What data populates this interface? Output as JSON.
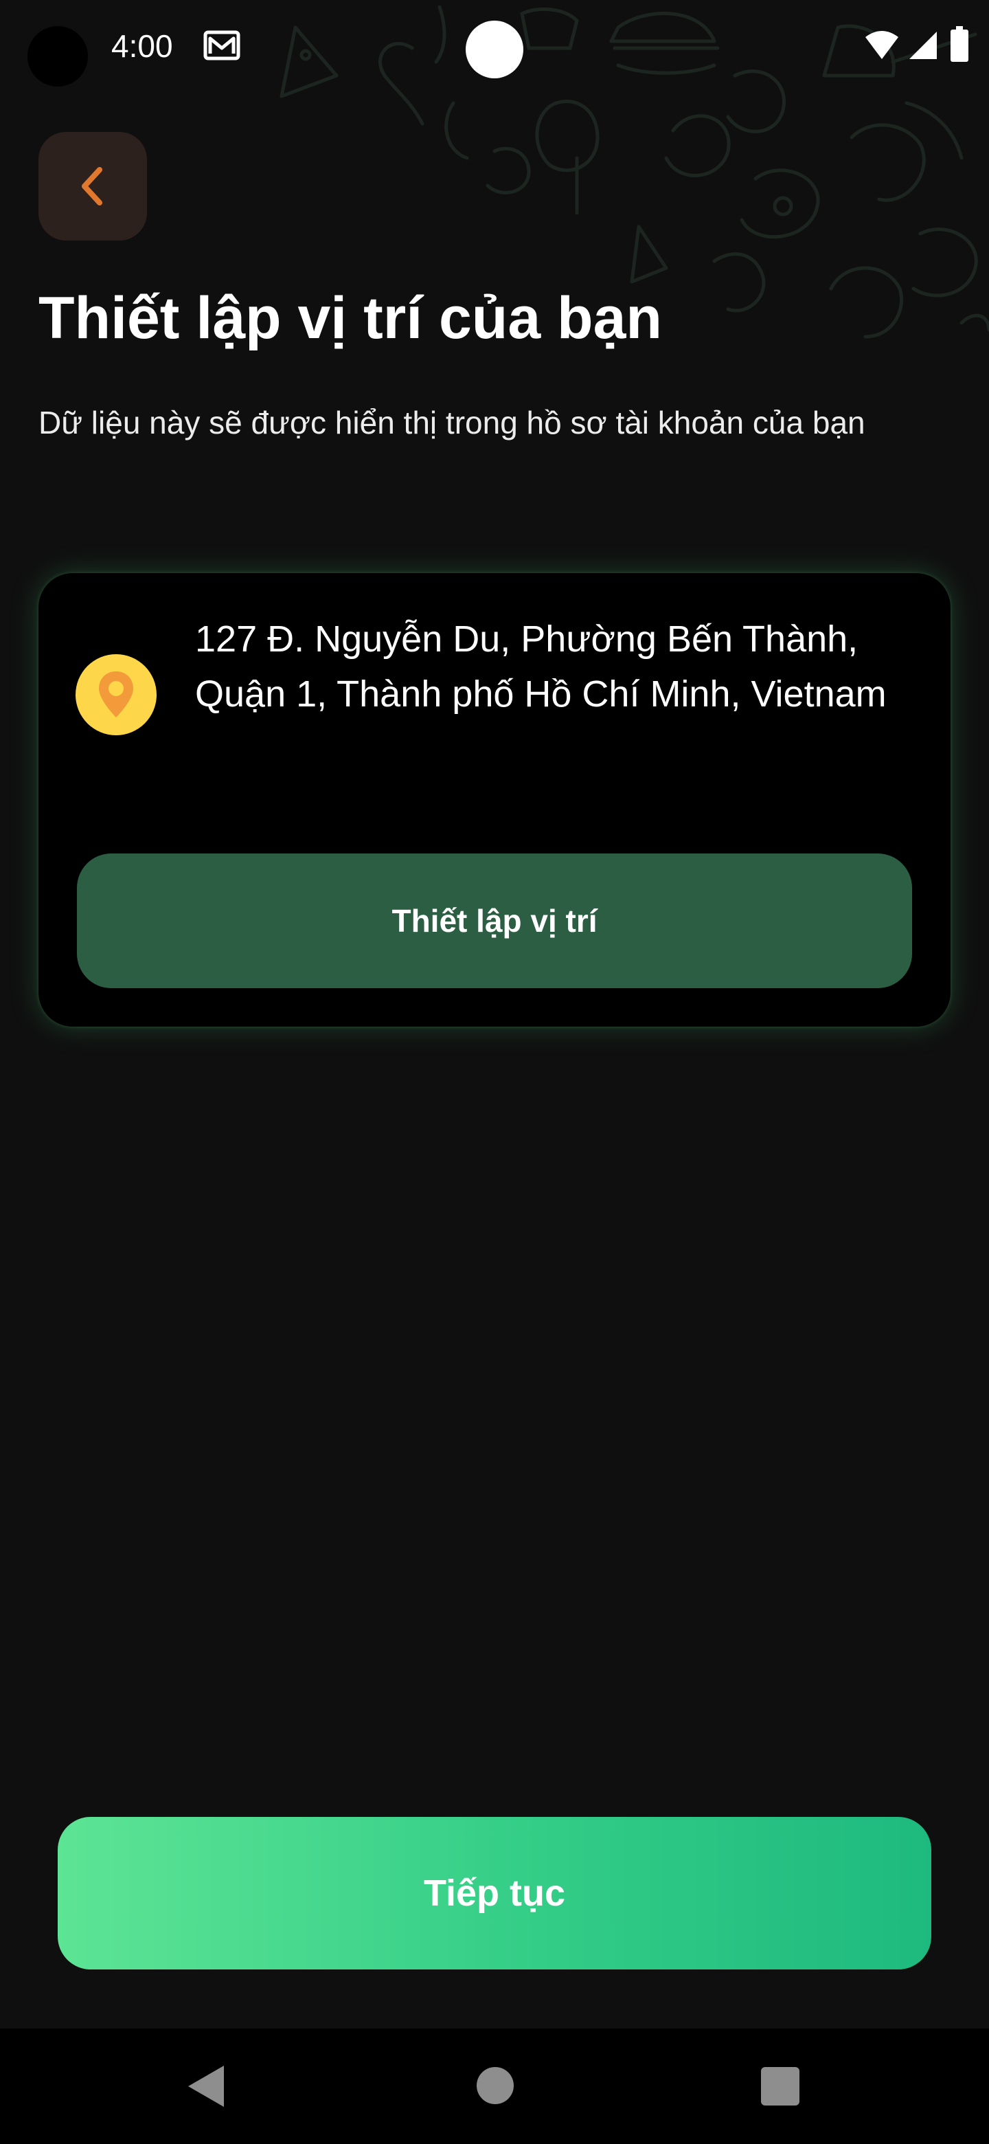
{
  "status_bar": {
    "time": "4:00",
    "icons": [
      "camera-hole",
      "mail-icon",
      "wifi-icon",
      "signal-icon",
      "battery-icon"
    ]
  },
  "header": {
    "back_icon": "chevron-left-icon",
    "title": "Thiết lập vị trí của bạn",
    "subtitle": "Dữ liệu này sẽ được hiển thị trong hồ sơ tài khoản của bạn"
  },
  "location_card": {
    "icon": "location-pin-icon",
    "address": "127 Đ. Nguyễn Du, Phường Bến Thành, Quận 1, Thành phố Hồ Chí Minh, Vietnam",
    "set_location_label": "Thiết lập vị trí"
  },
  "footer": {
    "continue_label": "Tiếp tục"
  },
  "nav_bar": {
    "icons": [
      "nav-back-icon",
      "nav-home-icon",
      "nav-recents-icon"
    ]
  },
  "colors": {
    "background": "#0f0f0f",
    "card": "#000000",
    "set_location_button": "#2c5e43",
    "continue_gradient_start": "#5de495",
    "continue_gradient_end": "#1eb97e",
    "back_button_bg": "#2c211d",
    "back_chevron": "#e0782e",
    "pin_circle": "#fdd64a",
    "pin_marker": "#f39a3a"
  }
}
